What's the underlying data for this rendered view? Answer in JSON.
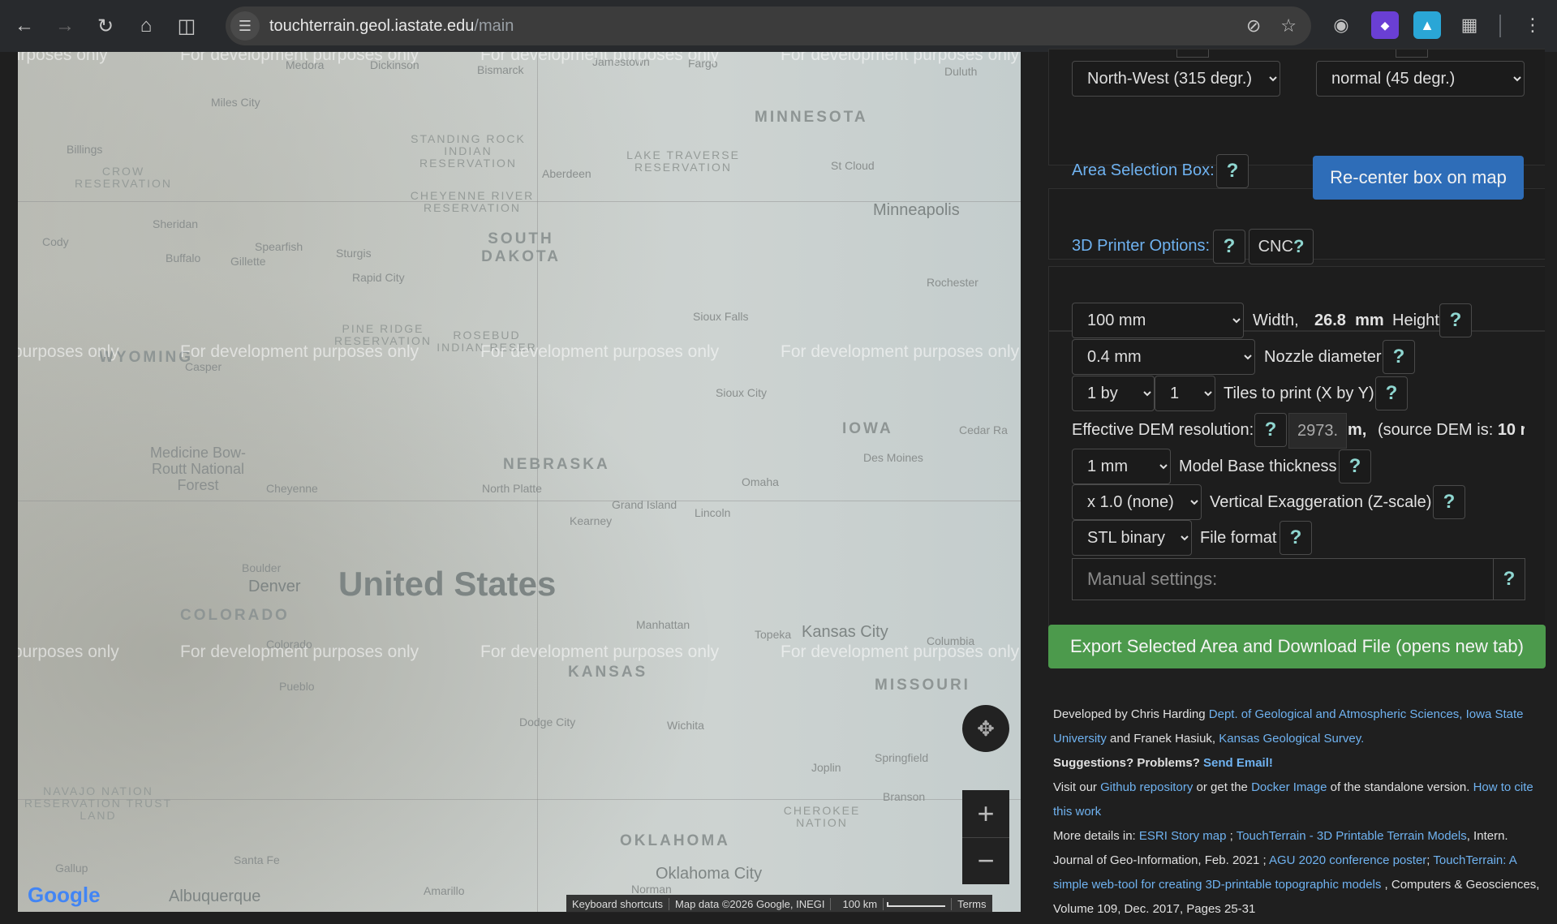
{
  "browser": {
    "url_host": "touchterrain.geol.iastate.edu",
    "url_path": "/main"
  },
  "map": {
    "country_label": "United States",
    "states": [
      "MINNESOTA",
      "SOUTH DAKOTA",
      "NEBRASKA",
      "IOWA",
      "KANSAS",
      "MISSOURI",
      "OKLAHOMA",
      "COLORADO",
      "WYOMING"
    ],
    "cities": {
      "minneapolis": "Minneapolis",
      "denver": "Denver",
      "kansas_city": "Kansas City",
      "oklahoma_city": "Oklahoma City",
      "albuquerque": "Albuquerque",
      "bismarck": "Bismarck",
      "aberdeen": "Aberdeen",
      "sioux_falls": "Sioux Falls",
      "sioux_city": "Sioux City",
      "des_moines": "Des Moines",
      "omaha": "Omaha",
      "lincoln": "Lincoln",
      "grand_island": "Grand Island",
      "north_platte": "North Platte",
      "kearney": "Kearney",
      "cheyenne": "Cheyenne",
      "boulder": "Boulder",
      "rapid_city": "Rapid City",
      "topeka": "Topeka",
      "wichita": "Wichita",
      "dodge_city": "Dodge City",
      "manhattan": "Manhattan",
      "pueblo": "Pueblo",
      "amarillo": "Amarillo",
      "st_cloud": "St Cloud",
      "rochester": "Rochester",
      "duluth": "Duluth",
      "fargo": "Fargo",
      "jamestown": "Jamestown",
      "springfield": "Springfield",
      "joplin": "Joplin",
      "columbia": "Columbia",
      "cedar_rapids": "Cedar Ra",
      "miles_city": "Miles City",
      "billings": "Billings",
      "sheridan": "Sheridan",
      "casper": "Casper",
      "sturgis": "Sturgis",
      "gillette": "Gillette",
      "buffalo": "Buffalo",
      "santa_fe": "Santa Fe",
      "norman": "Norman",
      "branson": "Branson",
      "cody": "Cody",
      "spearfish": "Spearfish",
      "medora": "Medora",
      "dickinson": "Dickinson",
      "colorado_springs": "Colorado",
      "gallup": "Gallup"
    },
    "reservations": {
      "standing_rock": "STANDING ROCK INDIAN RESERVATION",
      "cheyenne_river": "CHEYENNE RIVER RESERVATION",
      "lake_traverse": "LAKE TRAVERSE RESERVATION",
      "pine_ridge": "PINE RIDGE RESERVATION",
      "rosebud": "ROSEBUD INDIAN RESER",
      "crow": "CROW RESERVATION",
      "cherokee": "CHEROKEE NATION",
      "navajo": "NAVAJO NATION RESERVATION TRUST LAND"
    },
    "forest": "Medicine Bow-Routt National Forest",
    "dev_watermark": "For development purposes only",
    "dev_watermark_short": "purposes only",
    "dev_watermark_tail": "For development purposes only",
    "attribution": {
      "shortcuts": "Keyboard shortcuts",
      "mapdata": "Map data ©2026 Google, INEGI",
      "scale": "100 km",
      "terms": "Terms"
    },
    "logo": "Google"
  },
  "panel": {
    "hillshade_direction": "North-West (315 degr.)",
    "hillshade_angle": "normal (45 degr.)",
    "area_label": "Area Selection Box:",
    "recenter_button": "Re-center box on map",
    "printer_label": "3D Printer Options:",
    "cnc_label": "CNC",
    "width_value": "100 mm",
    "width_label": "Width,",
    "height_value": "26.8",
    "height_unit": "mm",
    "height_label": "Height",
    "nozzle_value": "0.4 mm",
    "nozzle_label": "Nozzle diameter",
    "tiles_x": "1 by",
    "tiles_y": "1",
    "tiles_label": "Tiles to print (X by Y)",
    "dem_label": "Effective DEM resolution:",
    "dem_value": "2973.",
    "dem_unit": "m,",
    "dem_source": "(source DEM is:",
    "dem_source_value": "10 r",
    "base_value": "1 mm",
    "base_label": "Model Base thickness",
    "zscale_value": "x 1.0 (none)",
    "zscale_label": "Vertical Exaggeration (Z-scale)",
    "format_value": "STL binary",
    "format_label": "File format",
    "manual_placeholder": "Manual settings:",
    "help_glyph": "?",
    "export_button": "Export Selected Area and Download File (opens new tab)"
  },
  "footer": {
    "dev_by": "Developed by Chris Harding",
    "iastate": "Dept. of Geological and Atmospheric Sciences, Iowa State University",
    "and": "and Franek Hasiuk,",
    "kgs": "Kansas Geological Survey.",
    "suggest": "Suggestions? Problems?",
    "send_email": "Send Email!",
    "visit": "Visit our",
    "github": "Github repository",
    "or_get": "or get the",
    "docker": "Docker Image",
    "standalone": "of the standalone version.",
    "cite": "How to cite this work",
    "more": "More details in:",
    "esri": "ESRI Story map",
    "semicolon": ";",
    "tt3d": "TouchTerrain - 3D Printable Terrain Models",
    "journal": ", Intern. Journal of Geo-Information, Feb. 2021 ;",
    "agu": "AGU 2020 conference poster",
    "semicolon2": ";",
    "ttweb": "TouchTerrain: A simple web-tool for creating 3D-printable topographic models",
    "cg": ", Computers & Geosciences, Volume 109, Dec. 2017, Pages 25-31"
  }
}
